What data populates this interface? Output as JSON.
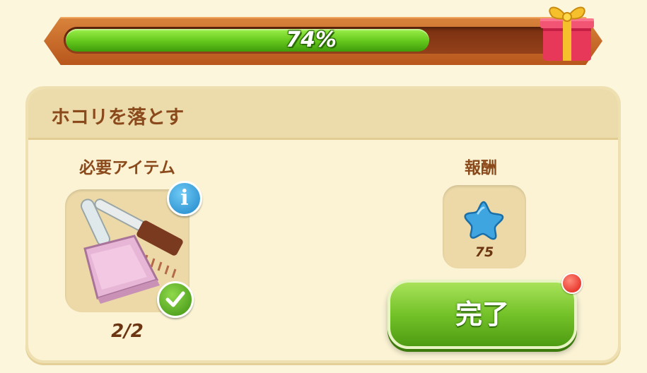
{
  "progress": {
    "label": "74%",
    "fraction": 0.74,
    "gift_icon": "gift-box-icon"
  },
  "task": {
    "title": "ホコリを落とす",
    "required_label": "必要アイテム",
    "item": {
      "icon": "dustpan-brush-icon",
      "count": "2/2"
    },
    "reward_label": "報酬",
    "reward": {
      "icon": "blue-star-icon",
      "value": "75"
    },
    "complete_button": "完了"
  },
  "colors": {
    "accent_green": "#74c229",
    "text_brown": "#8a4a1c",
    "panel_bg": "#fbf3d4"
  }
}
